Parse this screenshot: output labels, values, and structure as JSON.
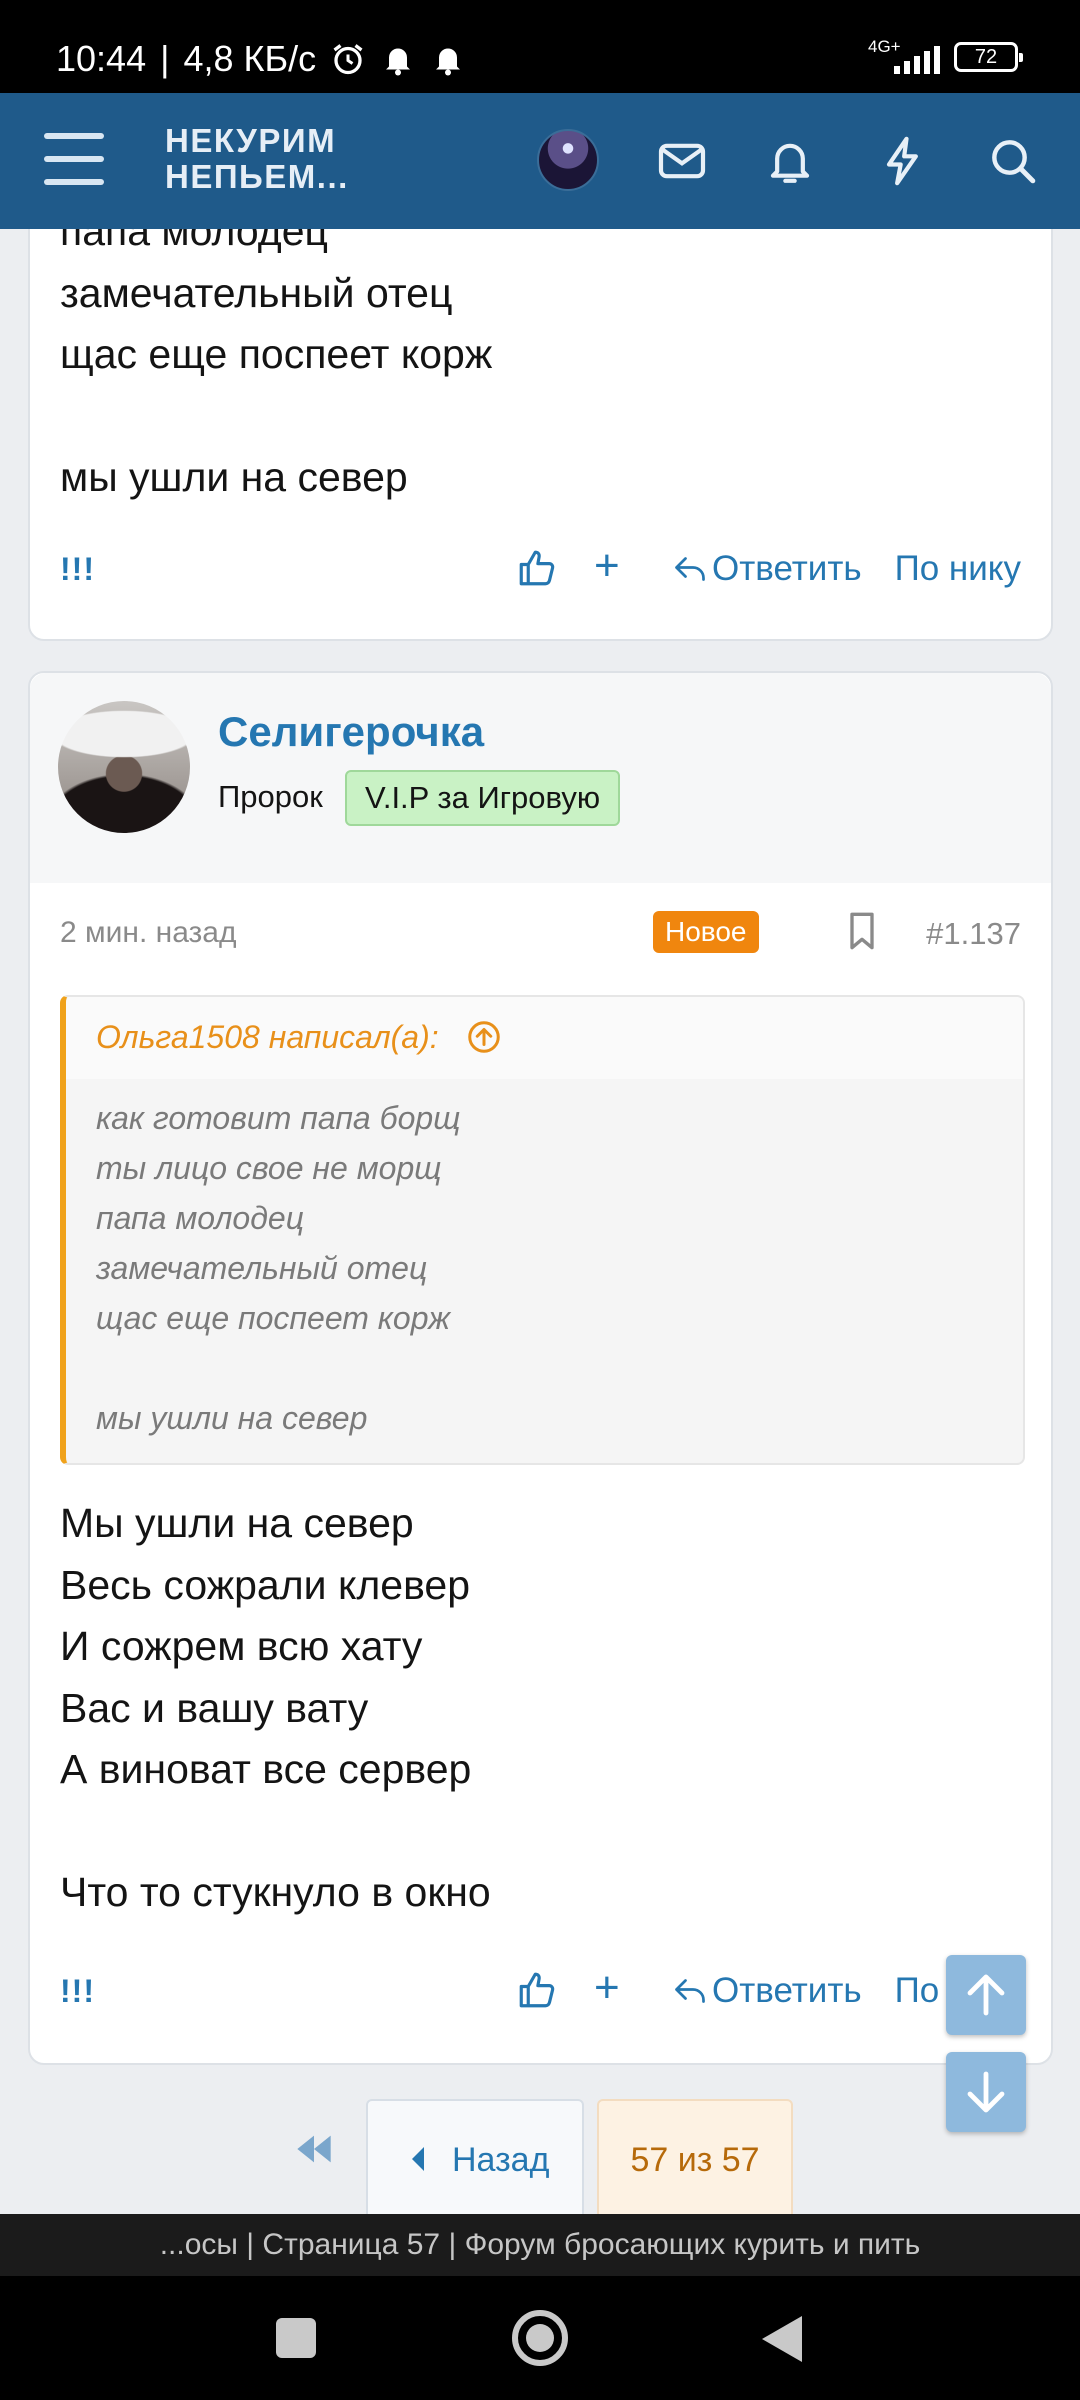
{
  "status_bar": {
    "time": "10:44",
    "speed": "4,8 КБ/с",
    "network": "4G+",
    "battery": "72"
  },
  "header": {
    "logo_line1": "НЕКУРИМ",
    "logo_line2": "НЕПЬЕМ..."
  },
  "prev_post": {
    "lines": [
      "папа молодец",
      "замечательный отец",
      "щас еще поспеет корж",
      "",
      "мы ушли на север"
    ],
    "actions": {
      "bang": "!!!",
      "plus": "+",
      "reply": "Ответить",
      "by_nick": "По нику"
    }
  },
  "post": {
    "username": "Селигерочка",
    "role": "Пророк",
    "badge": "V.I.P за Игровую",
    "time": "2 мин. назад",
    "new_label": "Новое",
    "number": "#1.137",
    "quote": {
      "author": "Ольга1508 написал(а):",
      "lines": [
        "как готовит папа борщ",
        "ты лицо свое не морщ",
        "папа молодец",
        "замечательный отец",
        "щас еще поспеет корж",
        "",
        "мы ушли на север"
      ]
    },
    "lines": [
      "Мы ушли на север",
      "Весь сожрали клевер",
      "И сожрем всю хату",
      "Вас и вашу вату",
      "А виноват все сервер",
      "",
      "Что то стукнуло в окно"
    ],
    "actions": {
      "bang": "!!!",
      "plus": "+",
      "reply": "Ответить",
      "by_nick": "По нику"
    }
  },
  "pagination": {
    "back": "Назад",
    "current": "57 из 57"
  },
  "browser": {
    "title": "...осы | Страница 57 | Форум бросающих курить и пить"
  },
  "colors": {
    "header_bg": "#1f5a8a",
    "link": "#2577b1",
    "new_badge": "#f0860e",
    "quote_accent": "#f0a21b"
  }
}
